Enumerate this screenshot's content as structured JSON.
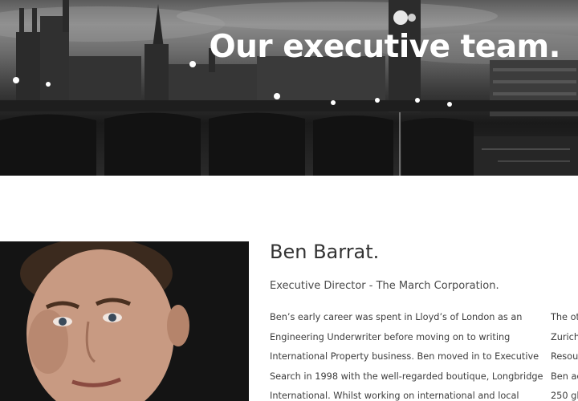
{
  "hero": {
    "title": "Our executive team."
  },
  "profile": {
    "name": "Ben Barrat.",
    "role": "Executive Director - The March Corporation.",
    "bio_lines": [
      "Ben’s early career was spent in Lloyd’s of London as an",
      "Engineering Underwriter before moving on to writing",
      "International Property business. Ben moved in to Executive",
      "Search in 1998 with the well-regarded boutique, Longbridge",
      "International. Whilst working on international and local"
    ],
    "bio_col2_lines": [
      "The ot",
      "Zurich",
      "Resou",
      "Ben ac",
      "250 gl"
    ]
  },
  "colors": {
    "text": "#3a3a3a",
    "hero_text": "#ffffff",
    "background": "#ffffff"
  }
}
